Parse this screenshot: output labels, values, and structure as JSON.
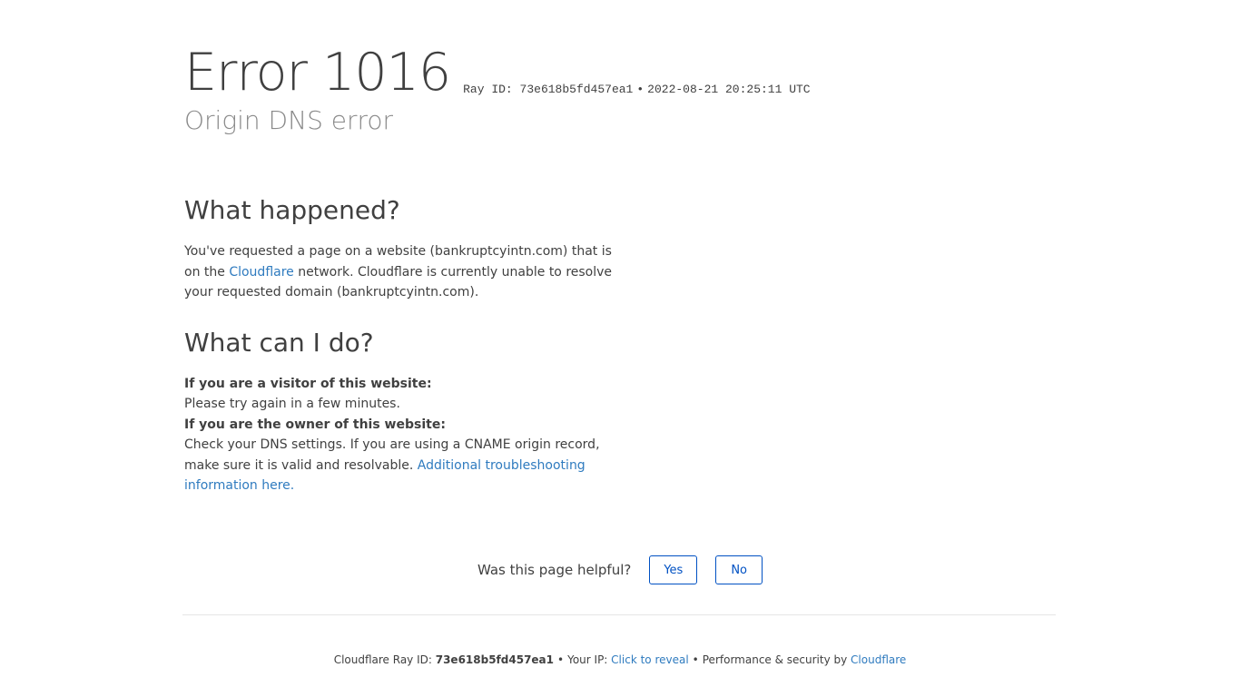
{
  "header": {
    "error_title": "Error 1016",
    "ray_label": "Ray ID: 73e618b5fd457ea1",
    "separator": "•",
    "timestamp": "2022-08-21 20:25:11 UTC",
    "subtitle": "Origin DNS error"
  },
  "what_happened": {
    "heading": "What happened?",
    "text_1": "You've requested a page on a website (bankruptcyintn.com) that is on the ",
    "cloudflare_link": "Cloudflare",
    "text_2": " network. Cloudflare is currently unable to resolve your requested domain (bankruptcyintn.com)."
  },
  "what_can_i_do": {
    "heading": "What can I do?",
    "visitor_label": "If you are a visitor of this website:",
    "visitor_text": "Please try again in a few minutes.",
    "owner_label": "If you are the owner of this website:",
    "owner_text": "Check your DNS settings. If you are using a CNAME origin record, make sure it is valid and resolvable. ",
    "troubleshoot_link": "Additional troubleshooting information here."
  },
  "feedback": {
    "question": "Was this page helpful?",
    "yes_label": "Yes",
    "no_label": "No"
  },
  "footer": {
    "ray_prefix": "Cloudflare Ray ID: ",
    "ray_id": "73e618b5fd457ea1",
    "separator": "•",
    "ip_prefix": "Your IP: ",
    "ip_link": "Click to reveal",
    "perf_text": "Performance & security by ",
    "cloudflare_link": "Cloudflare"
  },
  "colors": {
    "link": "#2f7bbf",
    "button_border": "#0051c3",
    "subtitle": "#8a8a8a",
    "text": "#404040"
  }
}
